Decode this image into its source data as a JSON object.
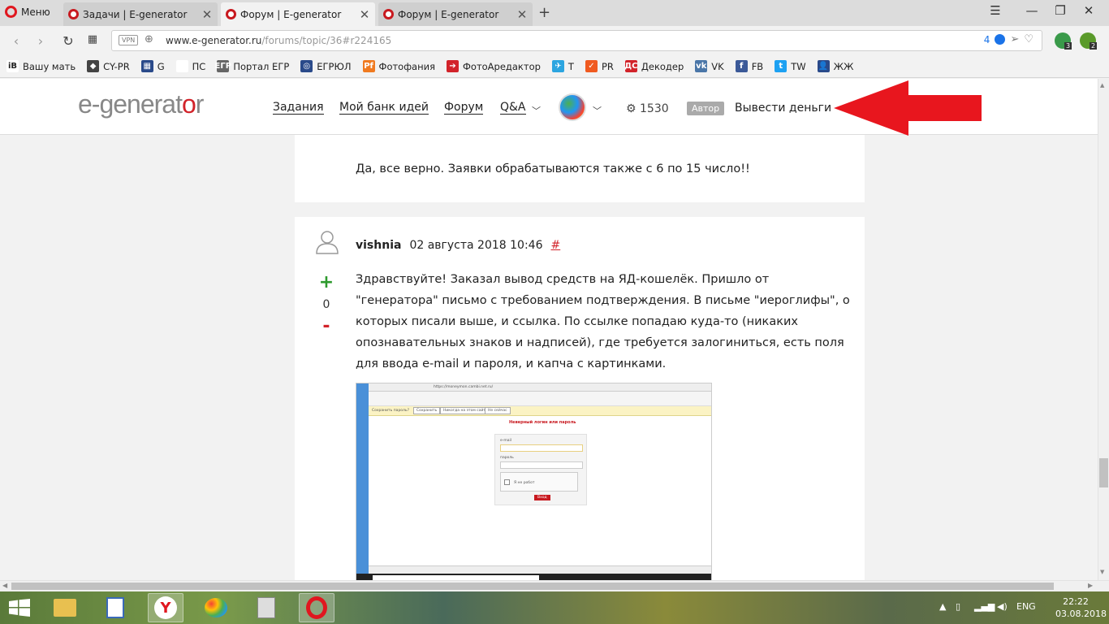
{
  "browser": {
    "menu_label": "Меню",
    "tabs": [
      {
        "title": "Задачи | E-generator",
        "active": false
      },
      {
        "title": "Форум | E-generator",
        "active": true
      },
      {
        "title": "Форум | E-generator",
        "active": false
      }
    ],
    "url_host": "www.e-generator.ru",
    "url_path": "/forums/topic/36#r224165",
    "vpn_label": "VPN",
    "ext_badges": [
      "4",
      "3",
      "2"
    ]
  },
  "bookmarks": [
    {
      "label": "Вашу мать",
      "icon_text": "iB",
      "color": "#ffffff"
    },
    {
      "label": "CY-PR",
      "icon_text": "◆",
      "color": "#444444"
    },
    {
      "label": "G",
      "icon_text": "▦",
      "color": "#2a4a8a"
    },
    {
      "label": "ПС",
      "icon_text": "",
      "color": "#ffffff"
    },
    {
      "label": "Портал ЕГР",
      "icon_text": "ЕГР",
      "color": "#666666"
    },
    {
      "label": "ЕГРЮЛ",
      "icon_text": "◎",
      "color": "#2a4a8a"
    },
    {
      "label": "Фотофания",
      "icon_text": "Pf",
      "color": "#f07a20"
    },
    {
      "label": "ФотоAредактор",
      "icon_text": "➔",
      "color": "#d2232a"
    },
    {
      "label": "T",
      "icon_text": "✈",
      "color": "#2ca5e0"
    },
    {
      "label": "PR",
      "icon_text": "✓",
      "color": "#f05a20"
    },
    {
      "label": "Декодер",
      "icon_text": "ДС",
      "color": "#d2232a"
    },
    {
      "label": "VK",
      "icon_text": "vk",
      "color": "#4a76a8"
    },
    {
      "label": "FB",
      "icon_text": "f",
      "color": "#3b5998"
    },
    {
      "label": "TW",
      "icon_text": "t",
      "color": "#1da1f2"
    },
    {
      "label": "ЖЖ",
      "icon_text": "👤",
      "color": "#2a4a8a"
    }
  ],
  "site": {
    "logo_a": "e-generat",
    "logo_b": "o",
    "logo_c": "r",
    "nav": [
      "Задания",
      "Мой банк идей",
      "Форум",
      "Q&A"
    ],
    "balance": "1530",
    "role": "Автор",
    "withdraw": "Вывести деньги"
  },
  "posts": [
    {
      "text": "Да, все верно. Заявки обрабатываются также с 6 по 15 число!!"
    },
    {
      "author": "vishnia",
      "date": "02 августа 2018 10:46",
      "anchor": "#",
      "votes": "0",
      "vote_plus": "+",
      "vote_minus": "-",
      "lines": [
        "Здравствуйте! Заказал вывод средств на ЯД-кошелёк. Пришло от",
        "\"генератора\" письмо с требованием подтверждения. В письме \"иероглифы\", о",
        "которых писали выше, и ссылка. По ссылке попадаю куда-то (никаких",
        "опознавательных знаков и надписей), где требуется залогиниться, есть поля",
        "для ввода e-mail и пароля, и капча с картинками."
      ]
    }
  ],
  "screenshot": {
    "url": "https://moneymon.cambi.net.ru/",
    "save_password": "Сохранить пароль?",
    "save_btn": "Сохранить",
    "never_btn": "Никогда на этом сайте",
    "notnow_btn": "Не сейчас",
    "error": "Неверный логин или пароль",
    "email_label": "e-mail",
    "password_label": "пароль",
    "captcha_label": "Я не робот",
    "submit": "Вход"
  },
  "taskbar": {
    "lang": "ENG",
    "time": "22:22",
    "date": "03.08.2018"
  },
  "colors": {
    "brand_red": "#d2232a",
    "plus_green": "#2e9a2e"
  }
}
